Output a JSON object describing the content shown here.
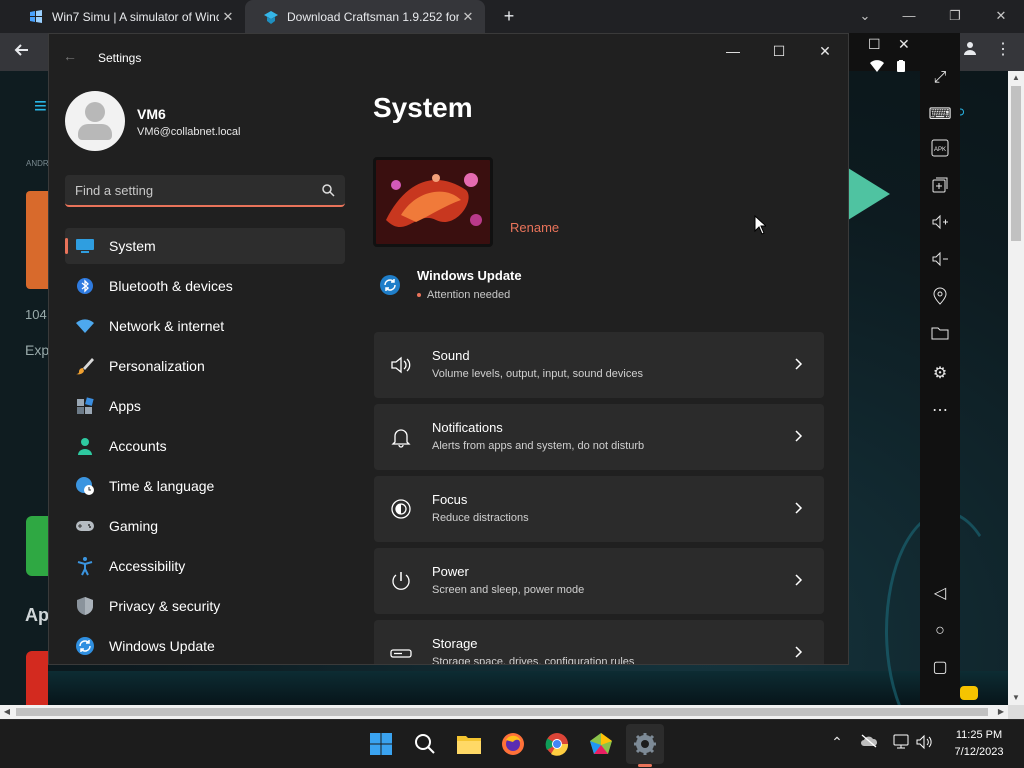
{
  "browser": {
    "tabs": [
      {
        "title": "Win7 Simu | A simulator of Wind",
        "close": "✕"
      },
      {
        "title": "Download Craftsman 1.9.252 for",
        "close": "✕"
      }
    ],
    "new_tab": "+",
    "window_controls": {
      "minimize": "—",
      "restore": "❐",
      "close": "✕"
    }
  },
  "emulator": {
    "left_texts": {
      "andr": "ANDR",
      "num": "104",
      "exp": "Exp",
      "apps": "Ap"
    }
  },
  "settings": {
    "window_title": "Settings",
    "profile": {
      "name": "VM6",
      "email": "VM6@collabnet.local"
    },
    "search_placeholder": "Find a setting",
    "nav": [
      {
        "label": "System",
        "icon": "system-icon"
      },
      {
        "label": "Bluetooth & devices",
        "icon": "bluetooth-icon"
      },
      {
        "label": "Network & internet",
        "icon": "wifi-icon"
      },
      {
        "label": "Personalization",
        "icon": "brush-icon"
      },
      {
        "label": "Apps",
        "icon": "apps-icon"
      },
      {
        "label": "Accounts",
        "icon": "accounts-icon"
      },
      {
        "label": "Time & language",
        "icon": "clock-globe-icon"
      },
      {
        "label": "Gaming",
        "icon": "gamepad-icon"
      },
      {
        "label": "Accessibility",
        "icon": "accessibility-icon"
      },
      {
        "label": "Privacy & security",
        "icon": "shield-icon"
      },
      {
        "label": "Windows Update",
        "icon": "update-icon"
      }
    ],
    "main": {
      "title": "System",
      "rename": "Rename",
      "windows_update": {
        "title": "Windows Update",
        "status": "Attention needed"
      },
      "cards": [
        {
          "title": "Sound",
          "subtitle": "Volume levels, output, input, sound devices",
          "icon": "speaker-icon"
        },
        {
          "title": "Notifications",
          "subtitle": "Alerts from apps and system, do not disturb",
          "icon": "bell-icon"
        },
        {
          "title": "Focus",
          "subtitle": "Reduce distractions",
          "icon": "focus-icon"
        },
        {
          "title": "Power",
          "subtitle": "Screen and sleep, power mode",
          "icon": "power-icon"
        },
        {
          "title": "Storage",
          "subtitle": "Storage space, drives, configuration rules",
          "icon": "storage-icon"
        }
      ]
    }
  },
  "taskbar": {
    "clock": {
      "time": "11:25 PM",
      "date": "7/12/2023"
    }
  },
  "colors": {
    "accent": "#e9735a",
    "bg": "#202020",
    "card": "#2b2b2b"
  }
}
